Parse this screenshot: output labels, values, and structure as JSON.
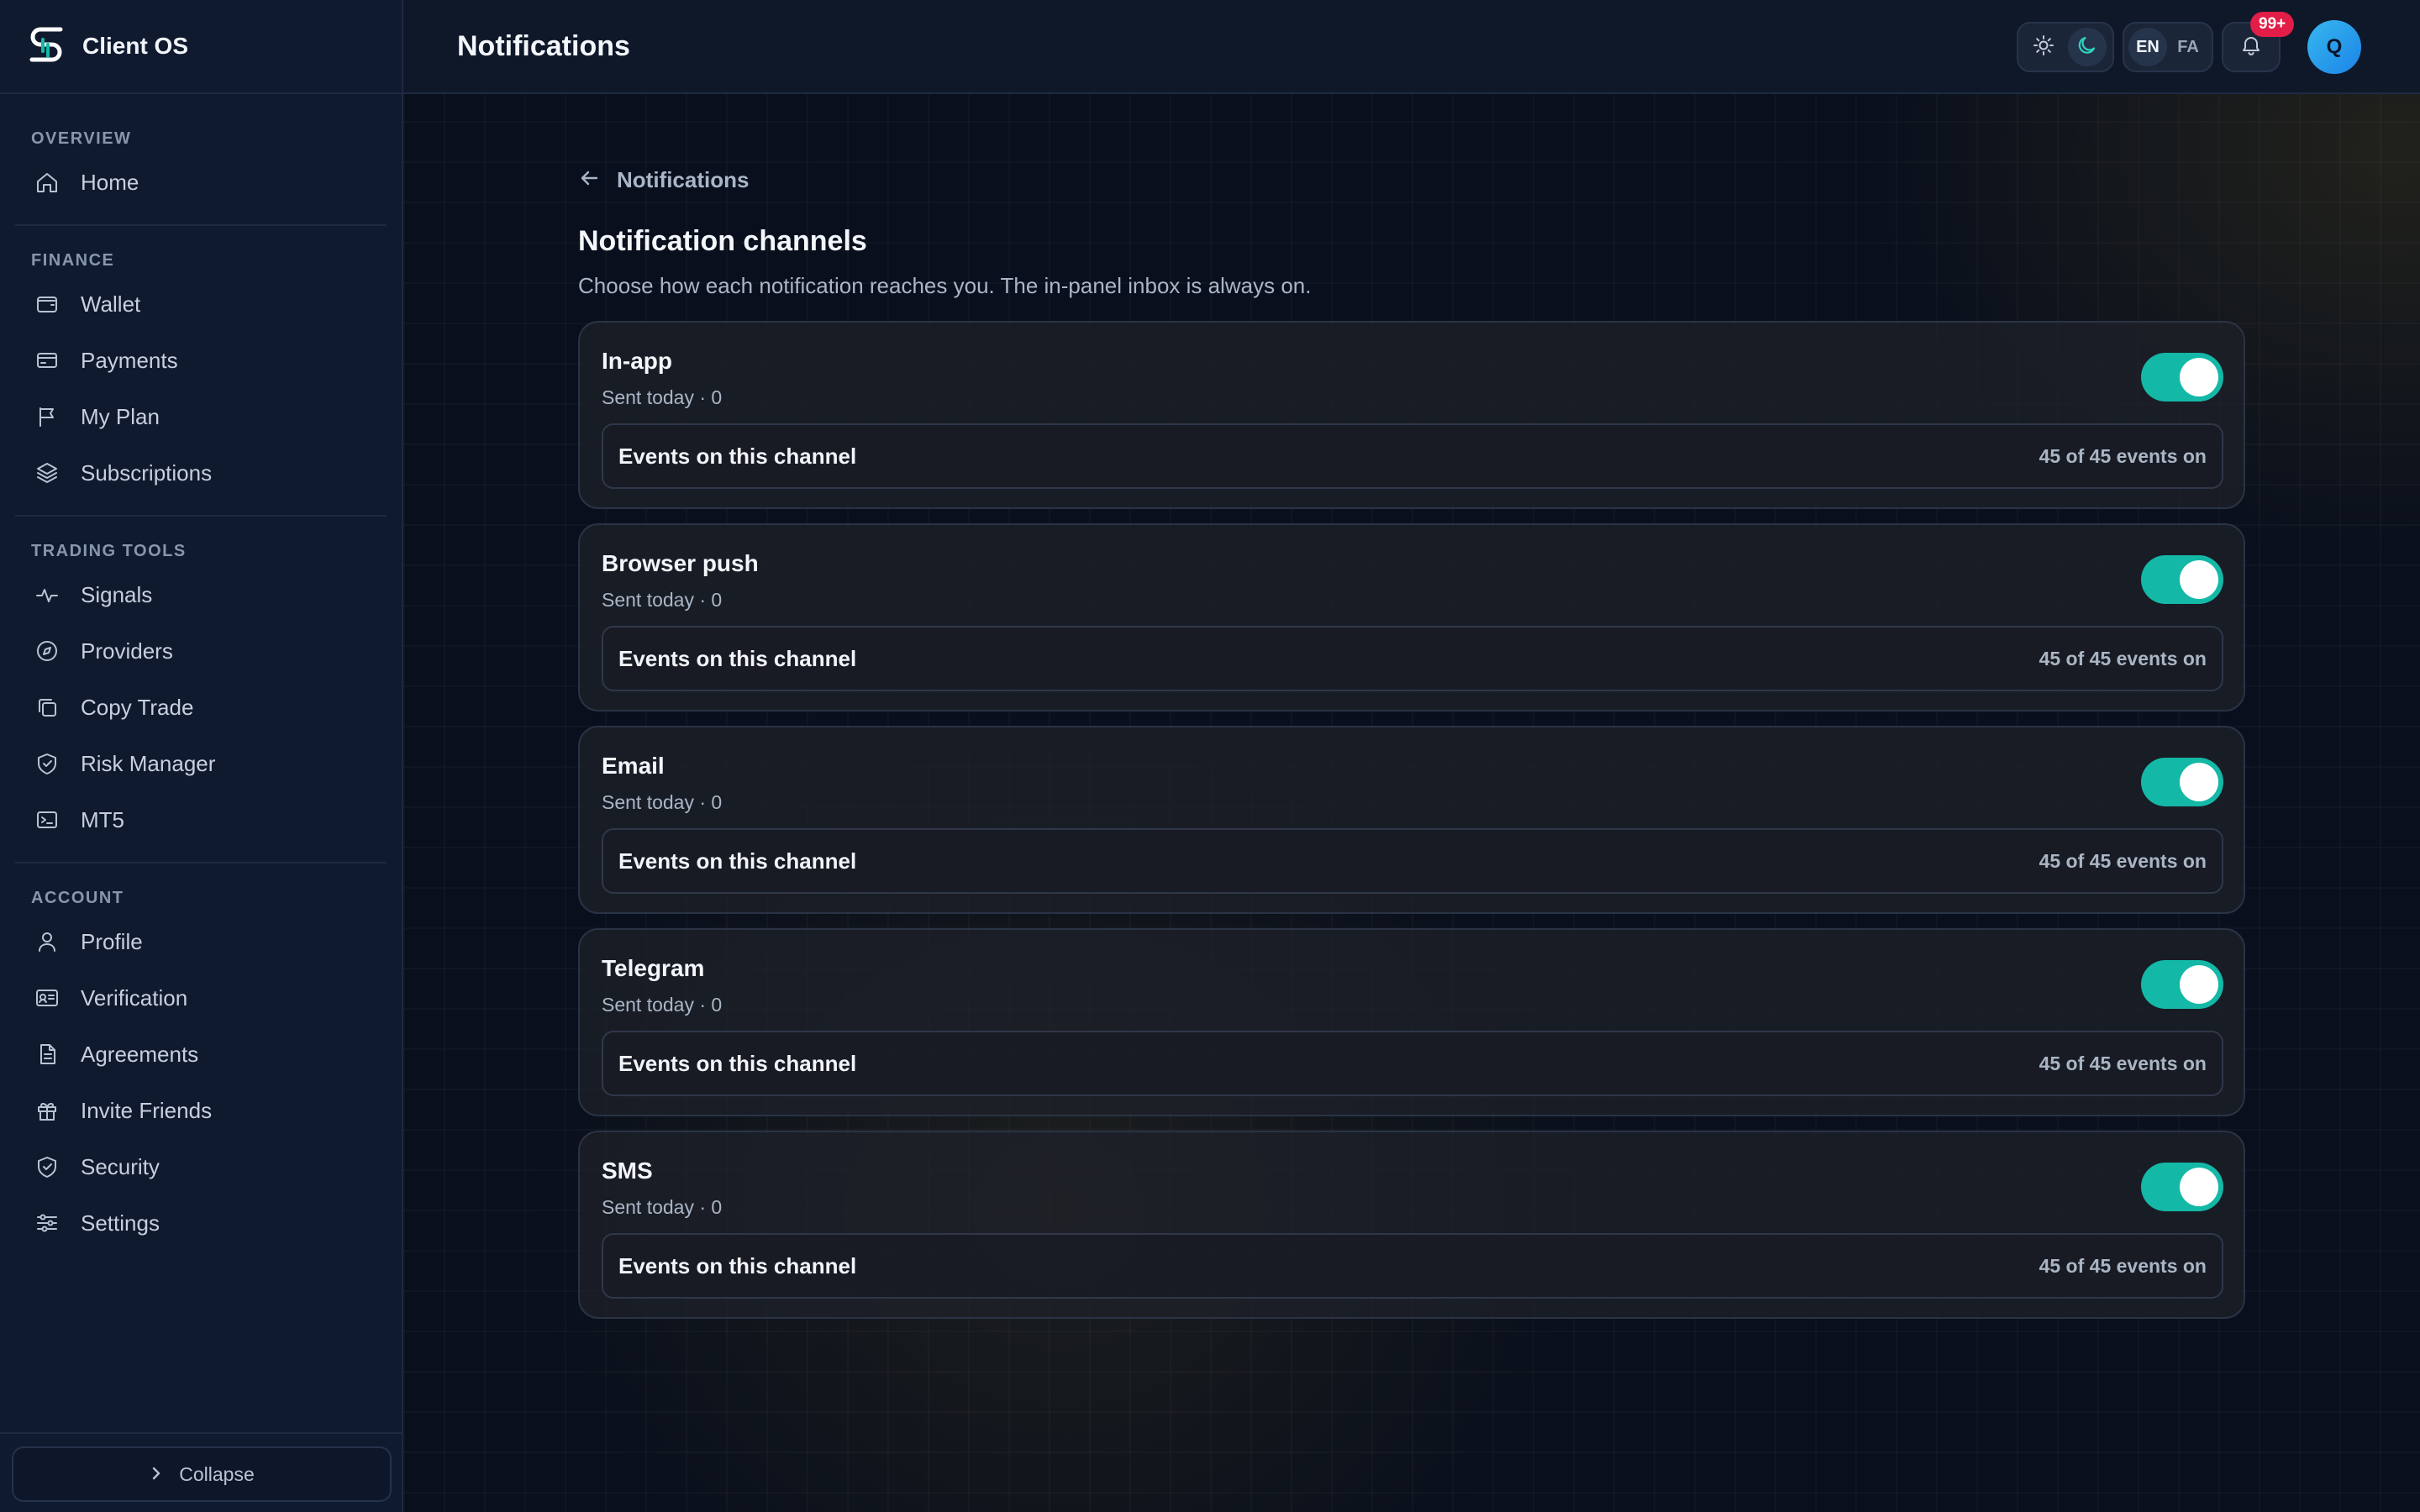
{
  "app": {
    "name": "Client OS"
  },
  "sidebar": {
    "sections": [
      {
        "title": "OVERVIEW",
        "items": [
          {
            "label": "Home",
            "icon": "home-icon"
          }
        ]
      },
      {
        "title": "FINANCE",
        "items": [
          {
            "label": "Wallet",
            "icon": "wallet-icon"
          },
          {
            "label": "Payments",
            "icon": "credit-card-icon"
          },
          {
            "label": "My Plan",
            "icon": "flag-icon"
          },
          {
            "label": "Subscriptions",
            "icon": "layers-icon"
          }
        ]
      },
      {
        "title": "TRADING TOOLS",
        "items": [
          {
            "label": "Signals",
            "icon": "activity-icon"
          },
          {
            "label": "Providers",
            "icon": "compass-icon"
          },
          {
            "label": "Copy Trade",
            "icon": "copy-icon"
          },
          {
            "label": "Risk Manager",
            "icon": "shield-check-icon"
          },
          {
            "label": "MT5",
            "icon": "terminal-icon"
          }
        ]
      },
      {
        "title": "ACCOUNT",
        "items": [
          {
            "label": "Profile",
            "icon": "user-icon"
          },
          {
            "label": "Verification",
            "icon": "id-card-icon"
          },
          {
            "label": "Agreements",
            "icon": "document-icon"
          },
          {
            "label": "Invite Friends",
            "icon": "gift-icon"
          },
          {
            "label": "Security",
            "icon": "shield-check-icon"
          },
          {
            "label": "Settings",
            "icon": "sliders-icon"
          }
        ]
      }
    ],
    "collapse_label": "Collapse"
  },
  "header": {
    "title": "Notifications",
    "lang": {
      "en": "EN",
      "fa": "FA"
    },
    "badge": "99+",
    "avatar_initial": "Q"
  },
  "page": {
    "back_label": "Notifications",
    "heading": "Notification channels",
    "description": "Choose how each notification reaches you. The in-panel inbox is always on."
  },
  "channels": [
    {
      "name": "In-app",
      "sent": "Sent today · 0",
      "enabled": true,
      "events_label": "Events on this channel",
      "events_count": "45 of 45 events on"
    },
    {
      "name": "Browser push",
      "sent": "Sent today · 0",
      "enabled": true,
      "events_label": "Events on this channel",
      "events_count": "45 of 45 events on"
    },
    {
      "name": "Email",
      "sent": "Sent today · 0",
      "enabled": true,
      "events_label": "Events on this channel",
      "events_count": "45 of 45 events on"
    },
    {
      "name": "Telegram",
      "sent": "Sent today · 0",
      "enabled": true,
      "events_label": "Events on this channel",
      "events_count": "45 of 45 events on"
    },
    {
      "name": "SMS",
      "sent": "Sent today · 0",
      "enabled": true,
      "events_label": "Events on this channel",
      "events_count": "45 of 45 events on"
    }
  ],
  "colors": {
    "accent": "#14b8a6",
    "badge": "#e11d48",
    "avatar": "#2aa3ee",
    "sidebar_bg": "#0f1a2e",
    "main_bg": "#090f1c"
  }
}
